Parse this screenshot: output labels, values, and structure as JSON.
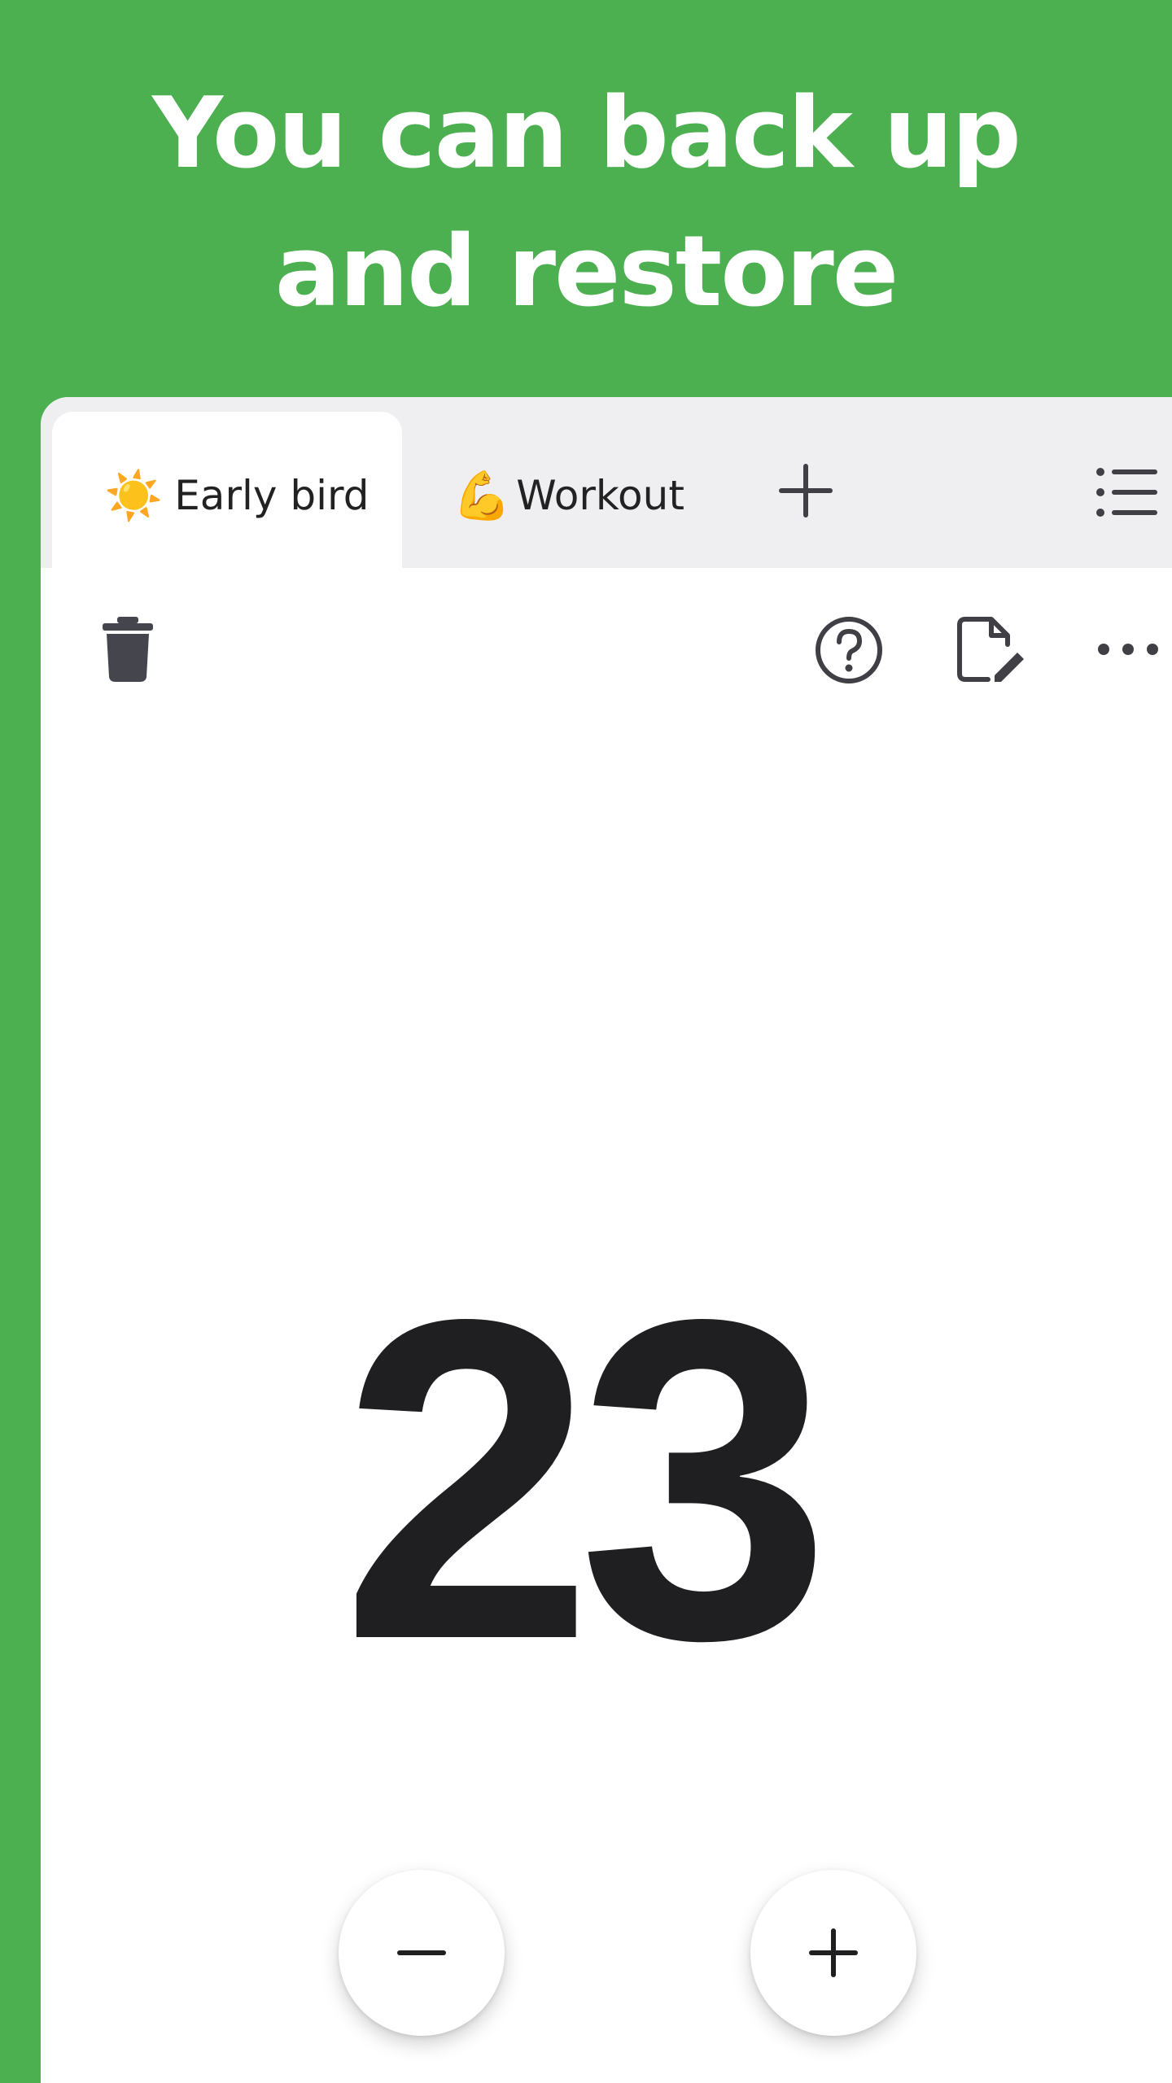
{
  "headline": {
    "line1": "You can back up",
    "line2": "and restore"
  },
  "tabs": [
    {
      "emoji": "☀️",
      "label": "Early bird",
      "active": true
    },
    {
      "emoji": "💪",
      "label": "Workout",
      "active": false
    }
  ],
  "icons": {
    "add_tab": "plus-icon",
    "list": "list-icon",
    "trash": "trash-icon",
    "help": "question-circle-icon",
    "edit": "edit-document-icon",
    "more": "more-dots-icon",
    "decrement": "minus-icon",
    "increment": "plus-icon"
  },
  "counter": {
    "value": "23"
  },
  "colors": {
    "background": "#4caf50",
    "tabbar": "#efeff1",
    "text": "#1f1e21",
    "icon": "#3f3f45"
  }
}
